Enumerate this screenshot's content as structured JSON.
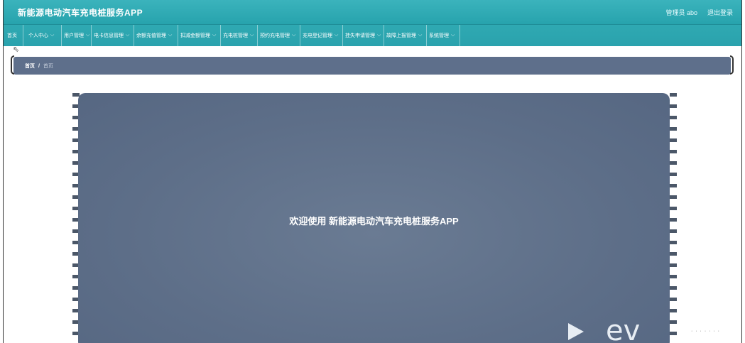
{
  "header": {
    "title": "新能源电动汽车充电桩服务APP",
    "user": "管理员 abo",
    "logout": "退出登录"
  },
  "nav": {
    "items": [
      {
        "label": "首页",
        "has_dropdown": false
      },
      {
        "label": "个人中心",
        "has_dropdown": true
      },
      {
        "label": "用户管理",
        "has_dropdown": true
      },
      {
        "label": "电卡信息管理",
        "has_dropdown": true
      },
      {
        "label": "余额充值管理",
        "has_dropdown": true
      },
      {
        "label": "扣减金额管理",
        "has_dropdown": true
      },
      {
        "label": "充电桩管理",
        "has_dropdown": true
      },
      {
        "label": "预约充电管理",
        "has_dropdown": true
      },
      {
        "label": "充电登记管理",
        "has_dropdown": true
      },
      {
        "label": "挂失申请管理",
        "has_dropdown": true
      },
      {
        "label": "故障上报管理",
        "has_dropdown": true
      },
      {
        "label": "系统管理",
        "has_dropdown": true
      }
    ],
    "dropdown_icon": "chevron-down-icon"
  },
  "breadcrumb": {
    "root": "首页",
    "separator": "/",
    "current": "首页"
  },
  "main": {
    "welcome": "欢迎使用 新能源电动汽车充电桩服务APP"
  },
  "watermark": {
    "brand": "ev",
    "icon": "play-triangle-icon"
  },
  "colors": {
    "header": "#2ea8b2",
    "card": "#5e6f8b"
  }
}
